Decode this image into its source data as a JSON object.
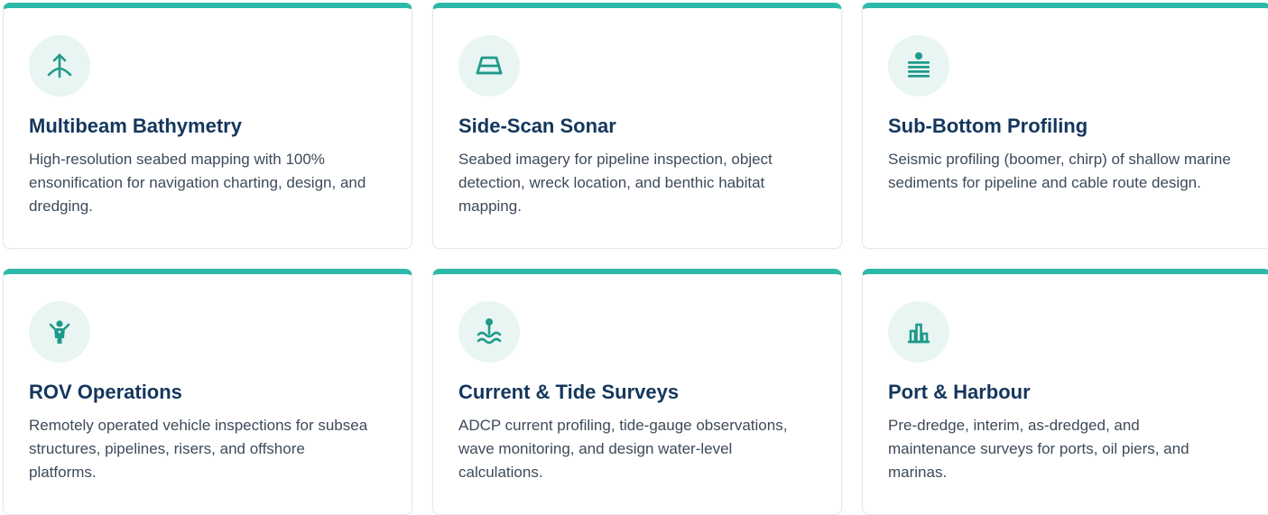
{
  "accent_color": "#2db9a8",
  "icon_color": "#1f9a8a",
  "title_color": "#14365c",
  "text_color": "#3d4a5a",
  "services": [
    {
      "icon": "anchor-icon",
      "title": "Multibeam Bathymetry",
      "description": "High-resolution seabed mapping with 100% ensonification for navigation charting, design, and dredging."
    },
    {
      "icon": "boat-icon",
      "title": "Side-Scan Sonar",
      "description": "Seabed imagery for pipeline inspection, object detection, wreck location, and benthic habitat mapping."
    },
    {
      "icon": "layers-icon",
      "title": "Sub-Bottom Profiling",
      "description": "Seismic profiling (boomer, chirp) of shallow marine sediments for pipeline and cable route design."
    },
    {
      "icon": "robot-icon",
      "title": "ROV Operations",
      "description": "Remotely operated vehicle inspections for subsea structures, pipelines, risers, and offshore platforms."
    },
    {
      "icon": "wave-gauge-icon",
      "title": "Current & Tide Surveys",
      "description": "ADCP current profiling, tide-gauge observations, wave monitoring, and design water-level calculations."
    },
    {
      "icon": "port-icon",
      "title": "Port & Harbour",
      "description": "Pre-dredge, interim, as-dredged, and maintenance surveys for ports, oil piers, and marinas."
    }
  ]
}
